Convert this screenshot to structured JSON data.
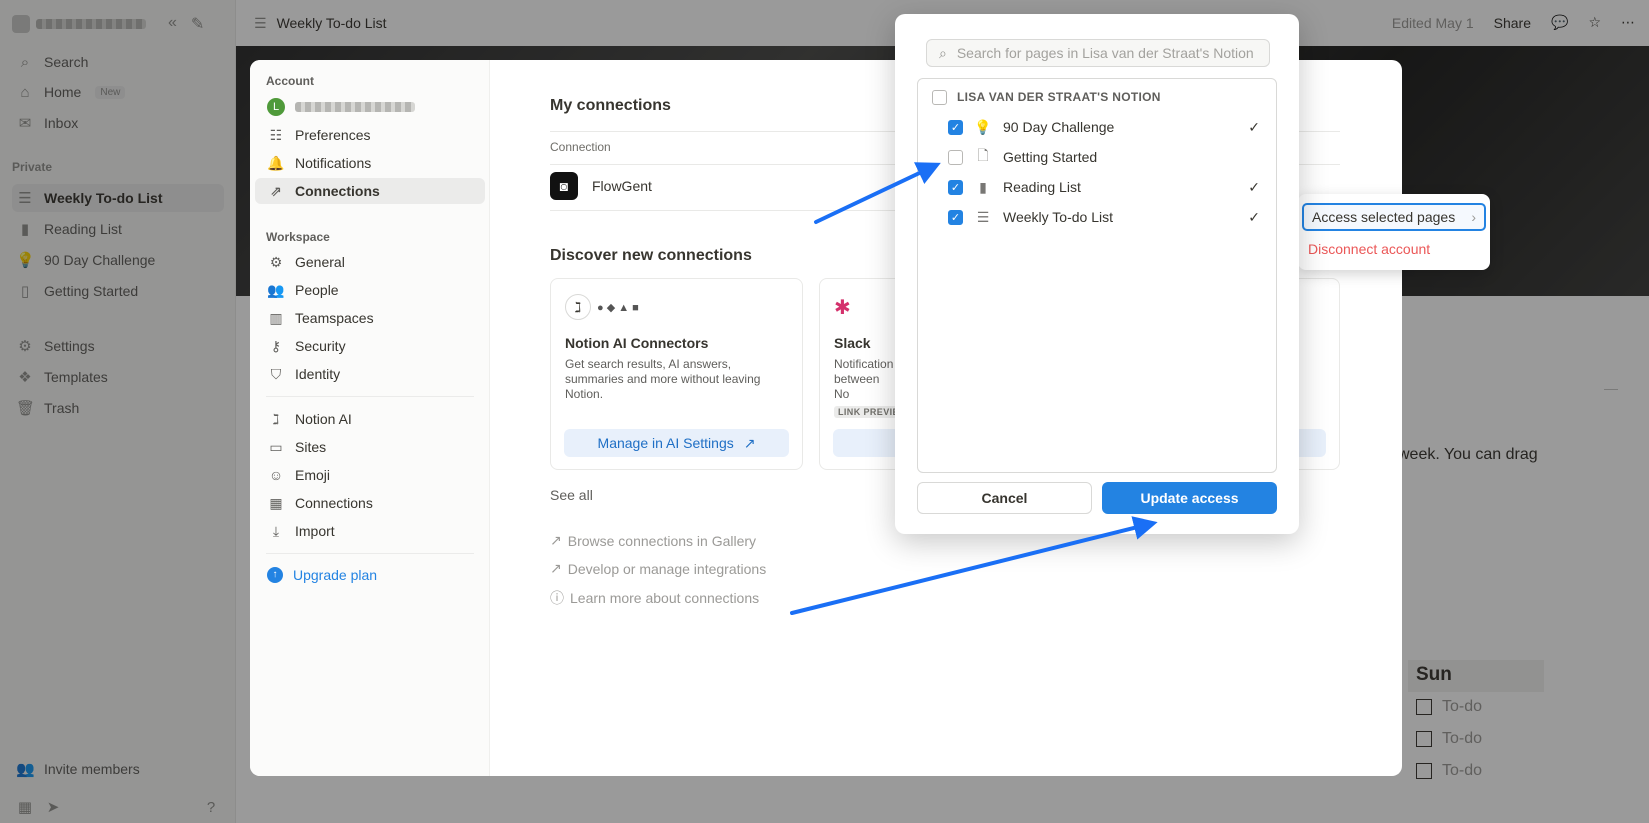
{
  "app": {
    "sidebar": {
      "items_top": [
        {
          "label": "Search",
          "icon": "search-icon"
        },
        {
          "label": "Home",
          "icon": "home-icon",
          "badge": "New"
        },
        {
          "label": "Inbox",
          "icon": "inbox-icon"
        }
      ],
      "private_label": "Private",
      "private_pages": [
        {
          "label": "Weekly To-do List",
          "icon": "list-icon"
        },
        {
          "label": "Reading List",
          "icon": "book-icon"
        },
        {
          "label": "90 Day Challenge",
          "icon": "lightbulb-icon"
        },
        {
          "label": "Getting Started",
          "icon": "page-icon"
        }
      ],
      "items_bottom": [
        {
          "label": "Settings",
          "icon": "gear-icon"
        },
        {
          "label": "Templates",
          "icon": "templates-icon"
        },
        {
          "label": "Trash",
          "icon": "trash-icon"
        }
      ],
      "invite_label": "Invite members"
    },
    "topbar": {
      "page_title": "Weekly To-do List",
      "edited": "Edited May 1",
      "share": "Share"
    },
    "page": {
      "body_text": "week. You can drag",
      "day_header": "Sun",
      "todo_placeholder": "To-do"
    }
  },
  "settings": {
    "account_label": "Account",
    "account_avatar_letter": "L",
    "account_nav": [
      {
        "label": "Preferences",
        "icon": "sliders-icon"
      },
      {
        "label": "Notifications",
        "icon": "bell-icon"
      },
      {
        "label": "Connections",
        "icon": "link-arrow-icon",
        "active": true
      }
    ],
    "workspace_label": "Workspace",
    "workspace_nav": [
      {
        "label": "General",
        "icon": "gear-icon"
      },
      {
        "label": "People",
        "icon": "people-icon"
      },
      {
        "label": "Teamspaces",
        "icon": "building-icon"
      },
      {
        "label": "Security",
        "icon": "key-icon"
      },
      {
        "label": "Identity",
        "icon": "shield-icon"
      }
    ],
    "more_nav": [
      {
        "label": "Notion AI",
        "icon": "notion-ai-icon"
      },
      {
        "label": "Sites",
        "icon": "sites-icon"
      },
      {
        "label": "Emoji",
        "icon": "smile-icon"
      },
      {
        "label": "Connections",
        "icon": "grid-icon"
      },
      {
        "label": "Import",
        "icon": "download-icon"
      }
    ],
    "upgrade_label": "Upgrade plan",
    "main": {
      "my_connections_title": "My connections",
      "column_header": "Connection",
      "connection_name": "FlowGent",
      "discover_title": "Discover new connections",
      "cards": [
        {
          "name": "Notion AI Connectors",
          "desc": "Get search results, AI answers, summaries and more without leaving Notion.",
          "button": "Manage in AI Settings"
        },
        {
          "name": "Slack",
          "desc": "Notification between No",
          "tag": "LINK PREVIE"
        }
      ],
      "see_all": "See all",
      "footer_links": [
        "Browse connections in Gallery",
        "Develop or manage integrations",
        "Learn more about connections"
      ]
    },
    "menu": {
      "access_selected": "Access selected pages",
      "disconnect": "Disconnect account",
      "disconnect_color": "#eb5757"
    }
  },
  "popup": {
    "search_placeholder": "Search for pages in Lisa van der Straat's Notion",
    "workspace_header": "LISA VAN DER STRAAT'S NOTION",
    "pages": [
      {
        "name": "90 Day Challenge",
        "icon": "lightbulb-icon",
        "checked": true
      },
      {
        "name": "Getting Started",
        "icon": "page-icon",
        "checked": false
      },
      {
        "name": "Reading List",
        "icon": "book-icon",
        "checked": true
      },
      {
        "name": "Weekly To-do List",
        "icon": "list-icon",
        "checked": true
      }
    ],
    "cancel_label": "Cancel",
    "update_label": "Update access",
    "accent": "#2383e2"
  }
}
